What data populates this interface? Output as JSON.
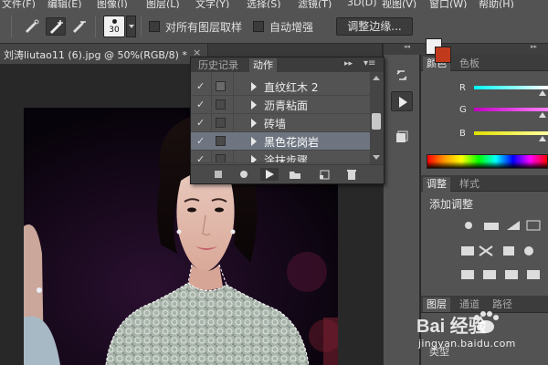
{
  "menubar": {
    "items": [
      "文件(F)",
      "编辑(E)",
      "图像(I)",
      "图层(L)",
      "文字(Y)",
      "选择(S)",
      "滤镜(T)",
      "3D(D)",
      "视图(V)",
      "窗口(W)",
      "帮助(H)"
    ]
  },
  "options": {
    "brush_size": "30",
    "sample_all_layers": "对所有图层取样",
    "auto_enhance": "自动增强",
    "refine_edge": "调整边缘..."
  },
  "document": {
    "tab_title": "刘涛liutao11 (6).jpg @ 50%(RGB/8) *",
    "close": "×"
  },
  "actions_panel": {
    "tabs": [
      "历史记录",
      "动作"
    ],
    "active_tab": "动作",
    "menu_glyph": "▸▸",
    "items": [
      {
        "label": "直纹红木 2",
        "checked": true,
        "selected": false
      },
      {
        "label": "沥青粘面",
        "checked": true,
        "selected": false
      },
      {
        "label": "砖墙",
        "checked": true,
        "selected": false
      },
      {
        "label": "黑色花岗岩",
        "checked": true,
        "selected": true
      },
      {
        "label": "涂抹步骤",
        "checked": true,
        "selected": false
      }
    ],
    "buttons": [
      "stop",
      "record",
      "play",
      "new-set",
      "new-action",
      "delete"
    ]
  },
  "color_panel": {
    "tabs": [
      "颜色",
      "色板"
    ],
    "channels": [
      "R",
      "G",
      "B"
    ],
    "foreground": "#f2f2f2",
    "background": "#c23a1c"
  },
  "adjust_panel": {
    "tabs": [
      "调整",
      "样式"
    ],
    "title": "添加调整"
  },
  "layers_panel": {
    "tabs": [
      "图层",
      "通道",
      "路径"
    ],
    "kind": "类型"
  },
  "watermark": {
    "brand": "Bai 经验",
    "url": "jingyan.baidu.com"
  }
}
